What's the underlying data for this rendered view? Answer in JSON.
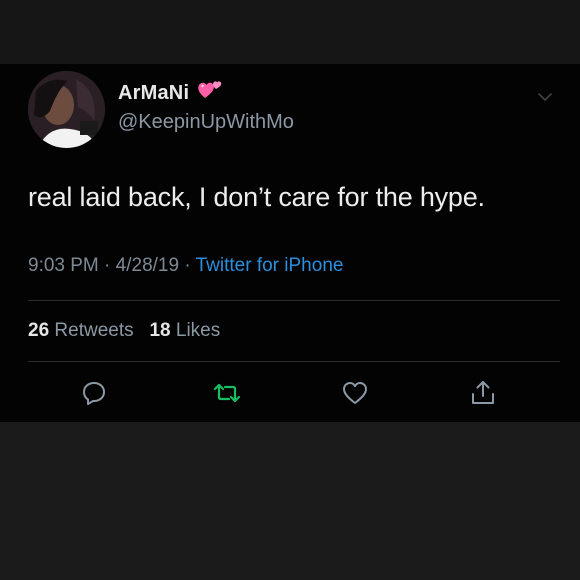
{
  "tweet": {
    "display_name": "ArMaNi",
    "name_emoji": "two-hearts-emoji",
    "handle": "@KeepinUpWithMo",
    "text": "real laid back, I don’t care for the hype.",
    "time": "9:03 PM",
    "date": "4/28/19",
    "source": "Twitter for iPhone",
    "separator": "·",
    "retweet_count": "26",
    "retweet_label": "Retweets",
    "like_count": "18",
    "like_label": "Likes"
  },
  "actions": [
    {
      "name": "reply",
      "icon": "speech-bubble-icon"
    },
    {
      "name": "retweet",
      "icon": "retweet-arrows-icon"
    },
    {
      "name": "like",
      "icon": "heart-outline-icon"
    },
    {
      "name": "share",
      "icon": "share-upload-icon"
    }
  ],
  "colors": {
    "background": "#030303",
    "text": "#ededed",
    "muted": "#8b98a5",
    "link": "#2b8fdc",
    "retweet_icon": "#17bf63",
    "emoji_pink": "#ff5fa8"
  }
}
